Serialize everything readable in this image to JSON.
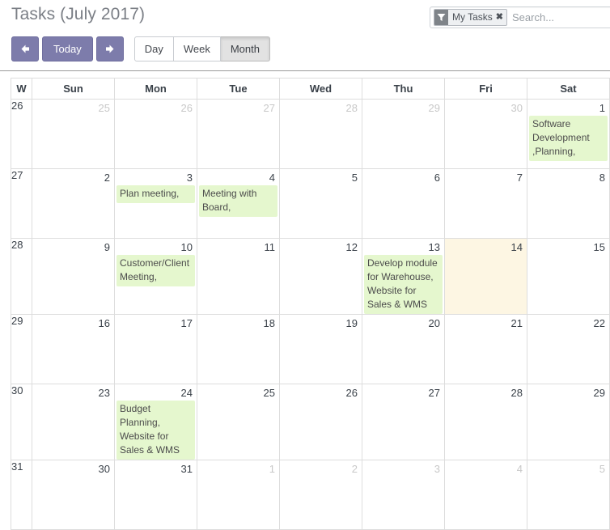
{
  "header": {
    "title": "Tasks (July 2017)",
    "search": {
      "facet_label": "My Tasks",
      "facet_icon": "filter-icon",
      "facet_close": "✖",
      "placeholder": "Search...",
      "value": ""
    },
    "toolbar": {
      "prev_label": "←",
      "today_label": "Today",
      "next_label": "→",
      "views": [
        {
          "label": "Day",
          "active": false
        },
        {
          "label": "Week",
          "active": false
        },
        {
          "label": "Month",
          "active": true
        }
      ]
    }
  },
  "calendar": {
    "columns": [
      "W",
      "Sun",
      "Mon",
      "Tue",
      "Wed",
      "Thu",
      "Fri",
      "Sat"
    ],
    "accent_purple": "#7d7cab",
    "event_green": "#e5f7ce",
    "today_cream": "#fdf6e3",
    "weeks": [
      {
        "week": "26",
        "days": [
          {
            "num": "25",
            "other": true,
            "today": false,
            "event": ""
          },
          {
            "num": "26",
            "other": true,
            "today": false,
            "event": ""
          },
          {
            "num": "27",
            "other": true,
            "today": false,
            "event": ""
          },
          {
            "num": "28",
            "other": true,
            "today": false,
            "event": ""
          },
          {
            "num": "29",
            "other": true,
            "today": false,
            "event": ""
          },
          {
            "num": "30",
            "other": true,
            "today": false,
            "event": ""
          },
          {
            "num": "1",
            "other": false,
            "today": false,
            "event": "Software Development ,Planning,"
          }
        ]
      },
      {
        "week": "27",
        "days": [
          {
            "num": "2",
            "other": false,
            "today": false,
            "event": ""
          },
          {
            "num": "3",
            "other": false,
            "today": false,
            "event": "Plan meeting,"
          },
          {
            "num": "4",
            "other": false,
            "today": false,
            "event": "Meeting with Board,"
          },
          {
            "num": "5",
            "other": false,
            "today": false,
            "event": ""
          },
          {
            "num": "6",
            "other": false,
            "today": false,
            "event": ""
          },
          {
            "num": "7",
            "other": false,
            "today": false,
            "event": ""
          },
          {
            "num": "8",
            "other": false,
            "today": false,
            "event": ""
          }
        ]
      },
      {
        "week": "28",
        "days": [
          {
            "num": "9",
            "other": false,
            "today": false,
            "event": ""
          },
          {
            "num": "10",
            "other": false,
            "today": false,
            "event": "Customer/Client Meeting,"
          },
          {
            "num": "11",
            "other": false,
            "today": false,
            "event": ""
          },
          {
            "num": "12",
            "other": false,
            "today": false,
            "event": ""
          },
          {
            "num": "13",
            "other": false,
            "today": false,
            "event": "Develop module for Warehouse, Website for Sales & WMS"
          },
          {
            "num": "14",
            "other": false,
            "today": true,
            "event": ""
          },
          {
            "num": "15",
            "other": false,
            "today": false,
            "event": ""
          }
        ]
      },
      {
        "week": "29",
        "days": [
          {
            "num": "16",
            "other": false,
            "today": false,
            "event": ""
          },
          {
            "num": "17",
            "other": false,
            "today": false,
            "event": ""
          },
          {
            "num": "18",
            "other": false,
            "today": false,
            "event": ""
          },
          {
            "num": "19",
            "other": false,
            "today": false,
            "event": ""
          },
          {
            "num": "20",
            "other": false,
            "today": false,
            "event": ""
          },
          {
            "num": "21",
            "other": false,
            "today": false,
            "event": ""
          },
          {
            "num": "22",
            "other": false,
            "today": false,
            "event": ""
          }
        ]
      },
      {
        "week": "30",
        "days": [
          {
            "num": "23",
            "other": false,
            "today": false,
            "event": ""
          },
          {
            "num": "24",
            "other": false,
            "today": false,
            "event": "Budget Planning, Website for Sales & WMS"
          },
          {
            "num": "25",
            "other": false,
            "today": false,
            "event": ""
          },
          {
            "num": "26",
            "other": false,
            "today": false,
            "event": ""
          },
          {
            "num": "27",
            "other": false,
            "today": false,
            "event": ""
          },
          {
            "num": "28",
            "other": false,
            "today": false,
            "event": ""
          },
          {
            "num": "29",
            "other": false,
            "today": false,
            "event": ""
          }
        ]
      },
      {
        "week": "31",
        "days": [
          {
            "num": "30",
            "other": false,
            "today": false,
            "event": ""
          },
          {
            "num": "31",
            "other": false,
            "today": false,
            "event": ""
          },
          {
            "num": "1",
            "other": true,
            "today": false,
            "event": ""
          },
          {
            "num": "2",
            "other": true,
            "today": false,
            "event": ""
          },
          {
            "num": "3",
            "other": true,
            "today": false,
            "event": ""
          },
          {
            "num": "4",
            "other": true,
            "today": false,
            "event": ""
          },
          {
            "num": "5",
            "other": true,
            "today": false,
            "event": ""
          }
        ]
      }
    ]
  }
}
